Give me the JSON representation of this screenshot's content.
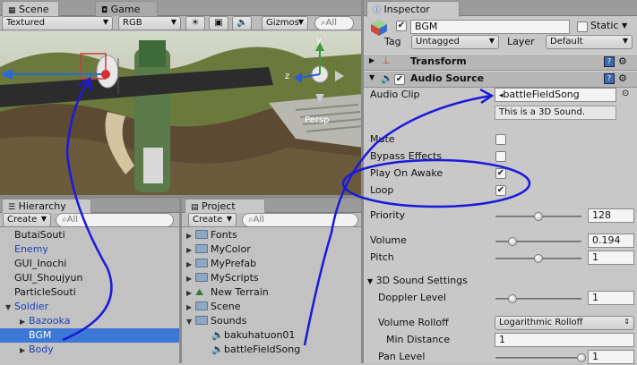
{
  "scene_panel": {
    "tabs": [
      {
        "label": "Scene"
      },
      {
        "label": "Game"
      }
    ],
    "render_mode": "Textured",
    "color_mode": "RGB",
    "gizmos_label": "Gizmos",
    "search_placeholder": "All",
    "persp_label": "Persp",
    "axis_y": "y",
    "axis_z": "z"
  },
  "hierarchy": {
    "tab_label": "Hierarchy",
    "create_label": "Create",
    "search_placeholder": "All",
    "items": [
      {
        "label": "ButaiSouti"
      },
      {
        "label": "Enemy"
      },
      {
        "label": "GUI_Inochi"
      },
      {
        "label": "GUI_Shoujyun"
      },
      {
        "label": "ParticleSouti"
      },
      {
        "label": "Soldier"
      },
      {
        "label": "Bazooka"
      },
      {
        "label": "BGM"
      },
      {
        "label": "Body"
      }
    ]
  },
  "project": {
    "tab_label": "Project",
    "create_label": "Create",
    "search_placeholder": "All",
    "items": [
      {
        "label": "Fonts"
      },
      {
        "label": "MyColor"
      },
      {
        "label": "MyPrefab"
      },
      {
        "label": "MyScripts"
      },
      {
        "label": "New Terrain"
      },
      {
        "label": "Scene"
      },
      {
        "label": "Sounds"
      },
      {
        "label": "bakuhatuon01"
      },
      {
        "label": "battleFieldSong"
      }
    ]
  },
  "inspector": {
    "tab_label": "Inspector",
    "object_name": "BGM",
    "static_label": "Static",
    "tag_label": "Tag",
    "tag_value": "Untagged",
    "layer_label": "Layer",
    "layer_value": "Default",
    "transform_label": "Transform",
    "audio_source_label": "Audio Source",
    "audio_clip_label": "Audio Clip",
    "audio_clip_value": "battleFieldSong",
    "info_text": "This is a 3D Sound.",
    "mute_label": "Mute",
    "bypass_label": "Bypass Effects",
    "play_on_awake_label": "Play On Awake",
    "loop_label": "Loop",
    "priority_label": "Priority",
    "priority_value": "128",
    "volume_label": "Volume",
    "volume_value": "0.194",
    "pitch_label": "Pitch",
    "pitch_value": "1",
    "sound3d_label": "3D Sound Settings",
    "doppler_label": "Doppler Level",
    "doppler_value": "1",
    "rolloff_label": "Volume Rolloff",
    "rolloff_value": "Logarithmic Rolloff",
    "min_distance_label": "Min Distance",
    "min_distance_value": "1",
    "pan_level_label": "Pan Level",
    "pan_level_value": "1",
    "mute_checked": false,
    "bypass_checked": false,
    "play_on_awake_checked": true,
    "loop_checked": true,
    "priority_slider": 0.5,
    "volume_slider": 0.194,
    "pitch_slider": 0.5,
    "doppler_slider": 0.2,
    "pan_slider": 1.0
  },
  "colors": {
    "annotation": "#1a1adc",
    "selection": "#3c78d6"
  }
}
